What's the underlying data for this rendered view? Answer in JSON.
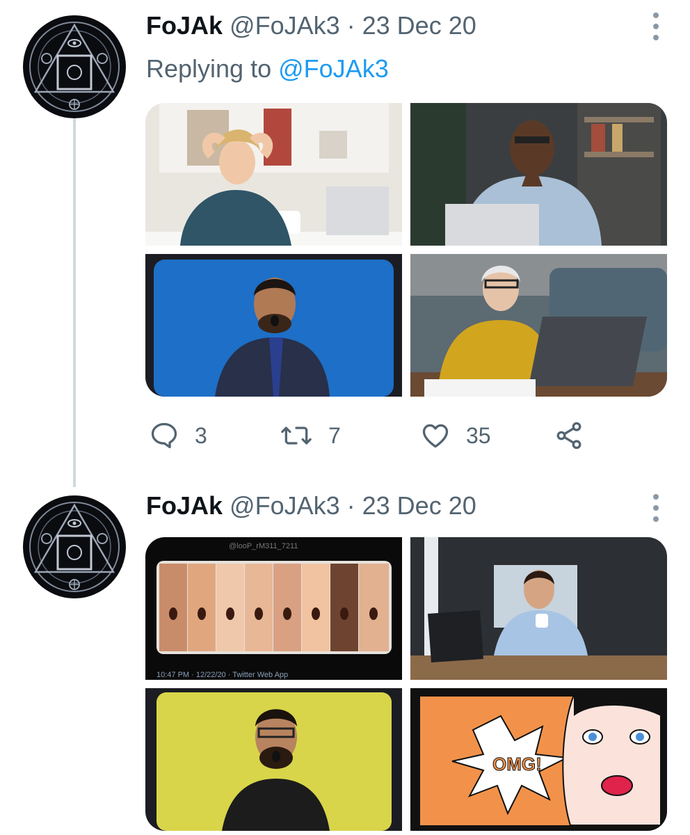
{
  "tweets": [
    {
      "name": "FoJAk",
      "handle": "@FoJAk3",
      "separator": "·",
      "date": "23 Dec 20",
      "replying_prefix": "Replying to",
      "replying_to": "@FoJAk3",
      "media": [
        {
          "icon": "woman-shocked-photo"
        },
        {
          "icon": "man-worried-laptop-photo"
        },
        {
          "icon": "man-shocked-blue-photo"
        },
        {
          "icon": "older-woman-laptop-photo"
        }
      ],
      "actions": {
        "replies": "3",
        "retweets": "7",
        "likes": "35"
      }
    },
    {
      "name": "FoJAk",
      "handle": "@FoJAk3",
      "separator": "·",
      "date": "23 Dec 20",
      "media": [
        {
          "icon": "shocked-faces-collage-photo",
          "watermark_top": "@looP_rM311_7211",
          "caption_bottom": "10:47 PM · 12/22/20 · Twitter Web App"
        },
        {
          "icon": "man-coffee-laptop-photo"
        },
        {
          "icon": "man-shocked-yellow-photo"
        },
        {
          "icon": "omg-comic-photo",
          "comic_text": "OMG!"
        }
      ]
    }
  ],
  "colors": {
    "text": "#0f1419",
    "secondary": "#536471",
    "accent": "#1d9bf0",
    "thread_line": "#cfd9de"
  }
}
